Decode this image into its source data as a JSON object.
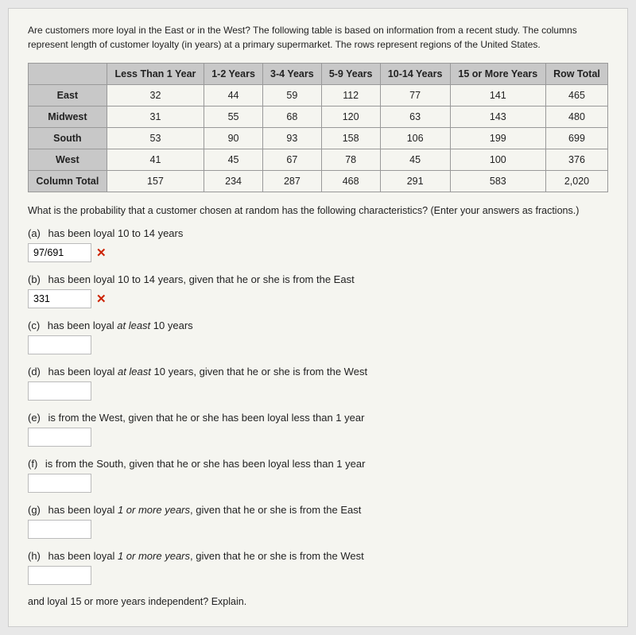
{
  "intro": {
    "text": "Are customers more loyal in the East or in the West? The following table is based on information from a recent study. The columns represent length of customer loyalty (in years) at a primary supermarket. The rows represent regions of the United States."
  },
  "table": {
    "headers": [
      "",
      "Less Than 1 Year",
      "1-2 Years",
      "3-4 Years",
      "5-9 Years",
      "10-14 Years",
      "15 or More Years",
      "Row Total"
    ],
    "rows": [
      {
        "label": "East",
        "values": [
          "32",
          "44",
          "59",
          "112",
          "77",
          "141",
          "465"
        ]
      },
      {
        "label": "Midwest",
        "values": [
          "31",
          "55",
          "68",
          "120",
          "63",
          "143",
          "480"
        ]
      },
      {
        "label": "South",
        "values": [
          "53",
          "90",
          "93",
          "158",
          "106",
          "199",
          "699"
        ]
      },
      {
        "label": "West",
        "values": [
          "41",
          "45",
          "67",
          "78",
          "45",
          "100",
          "376"
        ]
      }
    ],
    "totals": {
      "label": "Column Total",
      "values": [
        "157",
        "234",
        "287",
        "468",
        "291",
        "583",
        "2,020"
      ]
    }
  },
  "question_intro": "What is the probability that a customer chosen at random has the following characteristics? (Enter your answers as fractions.)",
  "questions": [
    {
      "part": "(a)",
      "text": "has been loyal 10 to 14 years",
      "has_input": true,
      "input_value": "97/691",
      "has_error": true
    },
    {
      "part": "(b)",
      "text": "has been loyal 10 to 14 years, given that he or she is from the East",
      "has_input": true,
      "input_value": "331",
      "has_error": true
    },
    {
      "part": "(c)",
      "text": "has been loyal at least 10 years",
      "has_input": true,
      "input_value": "",
      "has_error": false,
      "italic_word": "at least"
    },
    {
      "part": "(d)",
      "text": "has been loyal at least 10 years, given that he or she is from the West",
      "has_input": true,
      "input_value": "",
      "has_error": false,
      "italic_word": "at least"
    },
    {
      "part": "(e)",
      "text": "is from the West, given that he or she has been loyal less than 1 year",
      "has_input": true,
      "input_value": "",
      "has_error": false
    },
    {
      "part": "(f)",
      "text": "is from the South, given that he or she has been loyal less than 1 year",
      "has_input": true,
      "input_value": "",
      "has_error": false
    },
    {
      "part": "(g)",
      "text": "has been loyal 1 or more years, given that he or she is from the East",
      "has_input": true,
      "input_value": "",
      "has_error": false,
      "italic_word": "1 or more years"
    },
    {
      "part": "(h)",
      "text": "has been loyal 1 or more years, given that he or she is from the West",
      "has_input": true,
      "input_value": "",
      "has_error": false,
      "italic_word": "1 or more years"
    }
  ],
  "bottom_text": "and loyal 15 or more years independent? Explain."
}
